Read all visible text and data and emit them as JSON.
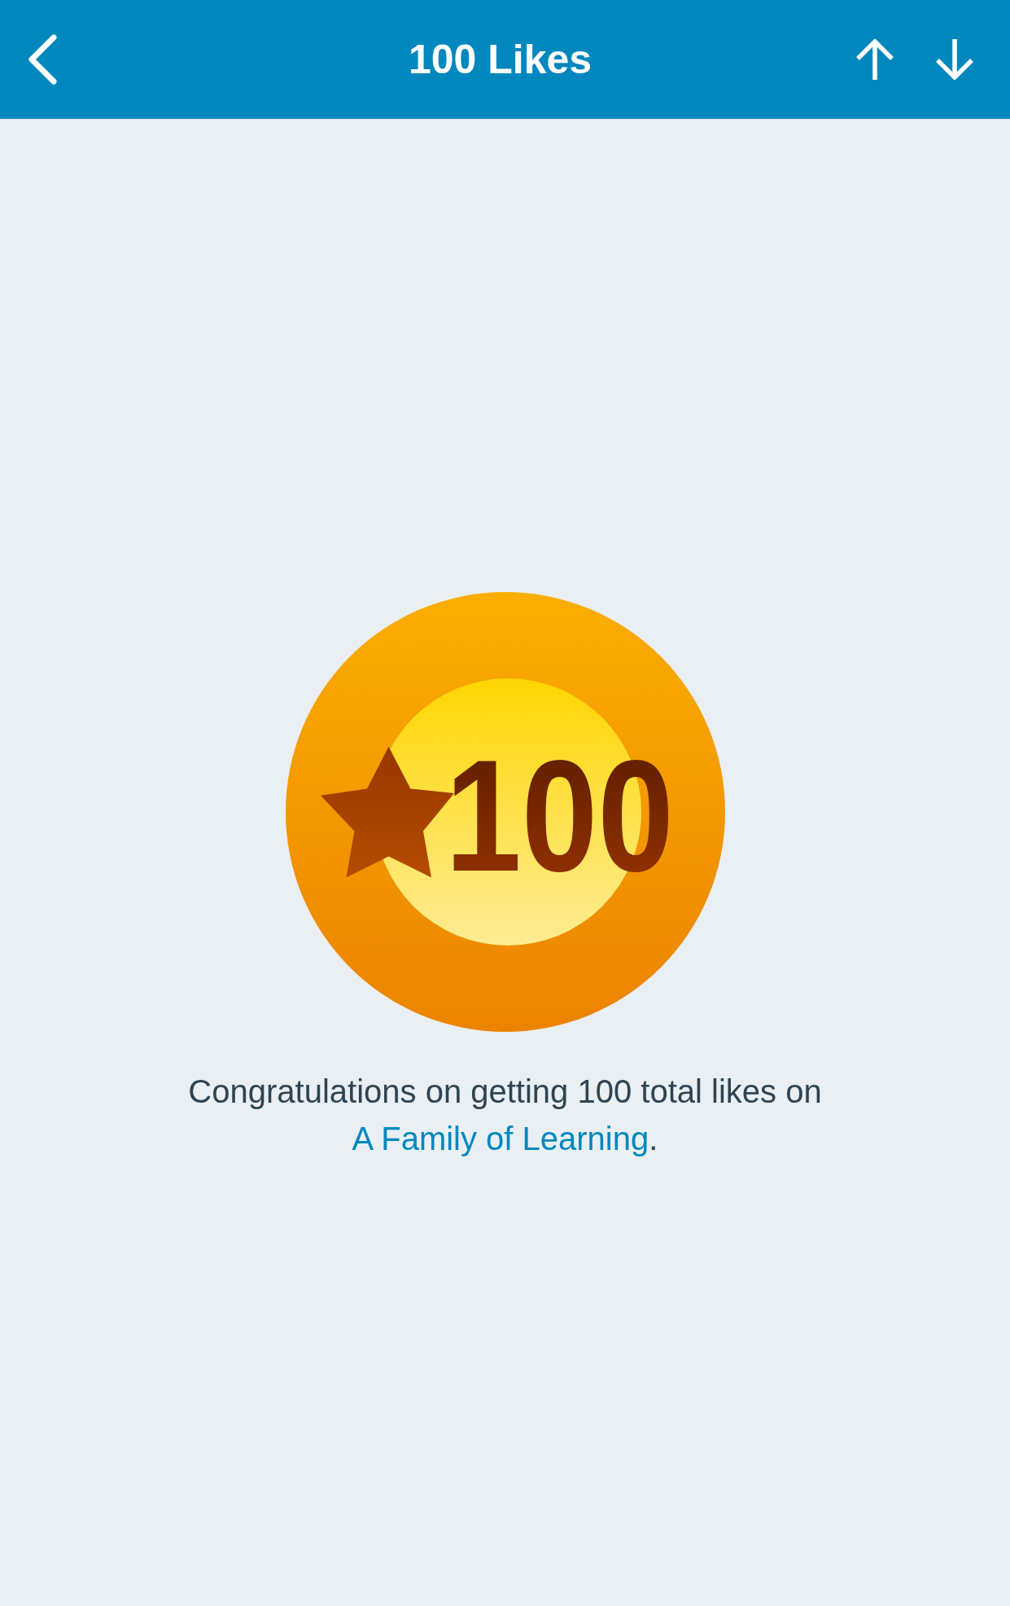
{
  "header": {
    "title": "100 Likes"
  },
  "badge": {
    "number": "100"
  },
  "message": {
    "text": "Congratulations on getting 100 total likes on ",
    "link": "A Family of Learning",
    "end": "."
  }
}
